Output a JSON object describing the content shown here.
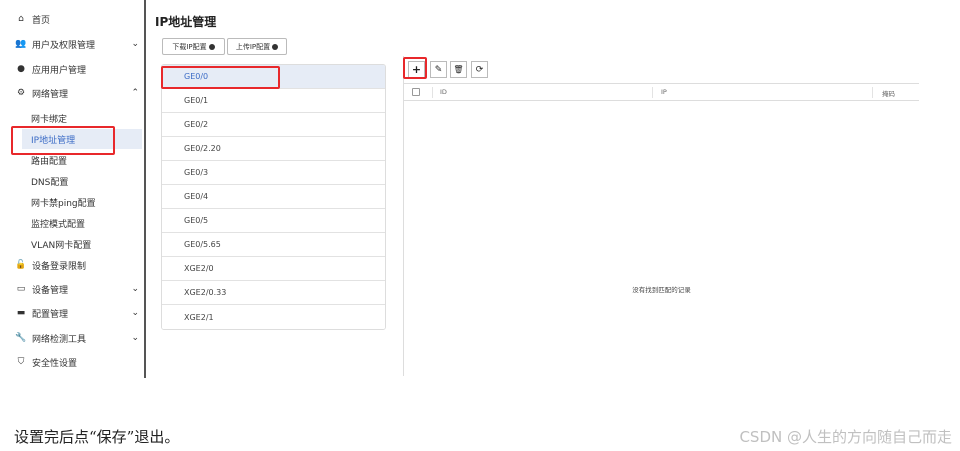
{
  "sidebar": {
    "items": [
      {
        "label": "首页",
        "icon": "home-icon"
      },
      {
        "label": "用户及权限管理",
        "icon": "users-icon",
        "chevron": "⌄"
      },
      {
        "label": "应用用户管理",
        "icon": "user-icon"
      },
      {
        "label": "网络管理",
        "icon": "gears-icon",
        "chevron": "⌃"
      },
      {
        "label": "设备登录限制",
        "icon": "unlock-icon"
      },
      {
        "label": "设备管理",
        "icon": "monitor-icon",
        "chevron": "⌄"
      },
      {
        "label": "配置管理",
        "icon": "briefcase-icon",
        "chevron": "⌄"
      },
      {
        "label": "网络检测工具",
        "icon": "wrench-icon",
        "chevron": "⌄"
      },
      {
        "label": "安全性设置",
        "icon": "shield-icon"
      }
    ],
    "network_sub": [
      {
        "label": "网卡绑定"
      },
      {
        "label": "IP地址管理"
      },
      {
        "label": "路由配置"
      },
      {
        "label": "DNS配置"
      },
      {
        "label": "网卡禁ping配置"
      },
      {
        "label": "监控模式配置"
      },
      {
        "label": "VLAN网卡配置"
      }
    ]
  },
  "page": {
    "title": "IP地址管理",
    "download_label": "下载IP配置",
    "upload_label": "上传IP配置"
  },
  "interfaces": [
    "GE0/0",
    "GE0/1",
    "GE0/2",
    "GE0/2.20",
    "GE0/3",
    "GE0/4",
    "GE0/5",
    "GE0/5.65",
    "XGE2/0",
    "XGE2/0.33",
    "XGE2/1"
  ],
  "table": {
    "columns": [
      "ID",
      "IP",
      "掩码"
    ],
    "empty_message": "没有找到匹配的记录",
    "toolbar": {
      "add": "+",
      "edit": "✎",
      "delete": "🗑",
      "refresh": "⟳"
    }
  },
  "doc": {
    "text": "设置完后点“保存”退出。",
    "watermark": "CSDN @人生的方向随自己而走"
  },
  "colors": {
    "accent": "#3c6cc6",
    "active_bg": "#e6ecf6",
    "highlight": "#e8282b"
  }
}
